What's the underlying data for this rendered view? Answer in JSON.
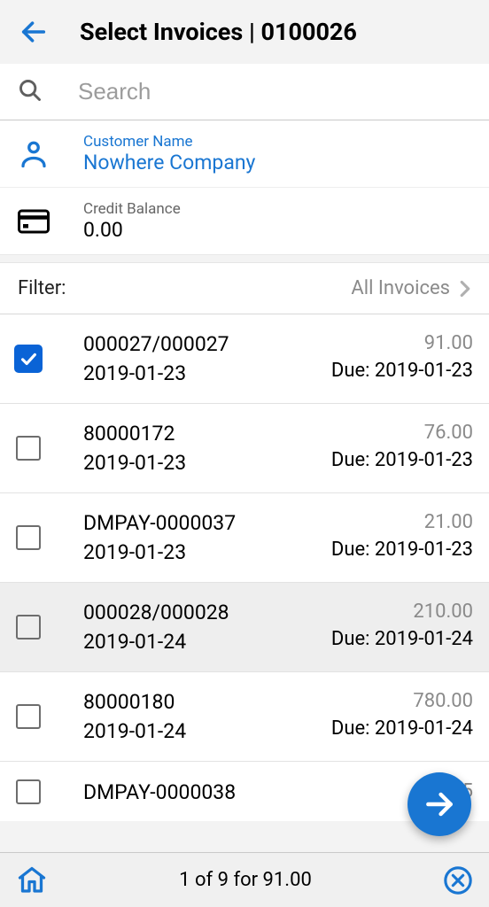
{
  "header": {
    "title": "Select Invoices | 0100026"
  },
  "search": {
    "placeholder": "Search"
  },
  "customer": {
    "name_label": "Customer Name",
    "name_value": "Nowhere Company",
    "credit_label": "Credit Balance",
    "credit_value": "0.00"
  },
  "filter": {
    "label": "Filter:",
    "value": "All Invoices"
  },
  "invoices": [
    {
      "number": "000027/000027",
      "date": "2019-01-23",
      "amount": "91.00",
      "due": "Due: 2019-01-23",
      "checked": true,
      "highlighted": false
    },
    {
      "number": "80000172",
      "date": "2019-01-23",
      "amount": "76.00",
      "due": "Due: 2019-01-23",
      "checked": false,
      "highlighted": false
    },
    {
      "number": "DMPAY-0000037",
      "date": "2019-01-23",
      "amount": "21.00",
      "due": "Due: 2019-01-23",
      "checked": false,
      "highlighted": false
    },
    {
      "number": "000028/000028",
      "date": "2019-01-24",
      "amount": "210.00",
      "due": "Due: 2019-01-24",
      "checked": false,
      "highlighted": true
    },
    {
      "number": "80000180",
      "date": "2019-01-24",
      "amount": "780.00",
      "due": "Due: 2019-01-24",
      "checked": false,
      "highlighted": false
    },
    {
      "number": "DMPAY-0000038",
      "date": "",
      "amount": "90.45",
      "due": "",
      "checked": false,
      "highlighted": false
    }
  ],
  "summary": "1 of 9 for 91.00"
}
